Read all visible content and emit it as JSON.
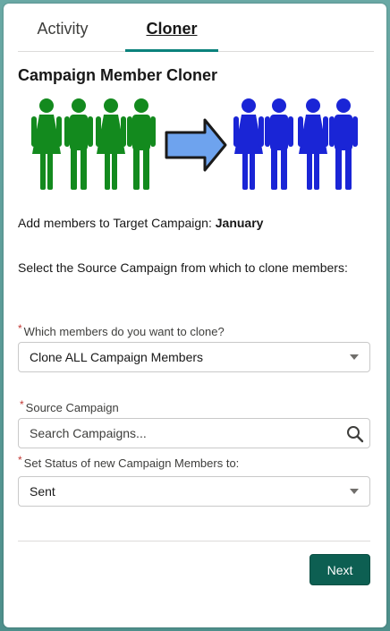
{
  "tabs": [
    {
      "label": "Activity",
      "active": false
    },
    {
      "label": "Cloner",
      "active": true
    }
  ],
  "title": "Campaign Member Cloner",
  "target": {
    "prefix": "Add members to Target Campaign: ",
    "campaign": "January"
  },
  "instructions": "Select the Source Campaign from which to clone members:",
  "members_field": {
    "required_mark": "*",
    "label": "Which members do you want to clone?",
    "value": "Clone ALL Campaign Members"
  },
  "source_field": {
    "required_mark": "*",
    "label": "Source Campaign",
    "placeholder": "Search Campaigns..."
  },
  "status_field": {
    "required_mark": "*",
    "label": "Set Status of new Campaign Members to:",
    "value": "Sent"
  },
  "next_label": "Next",
  "colors": {
    "source_people": "#138a1e",
    "target_people": "#1a25d6",
    "arrow": "#6ea3ee",
    "accent": "#0b827c",
    "button": "#0d5f52",
    "required": "#c23934"
  },
  "icons": [
    "person-icon",
    "arrow-right-icon",
    "search-icon",
    "chevron-down-icon"
  ]
}
